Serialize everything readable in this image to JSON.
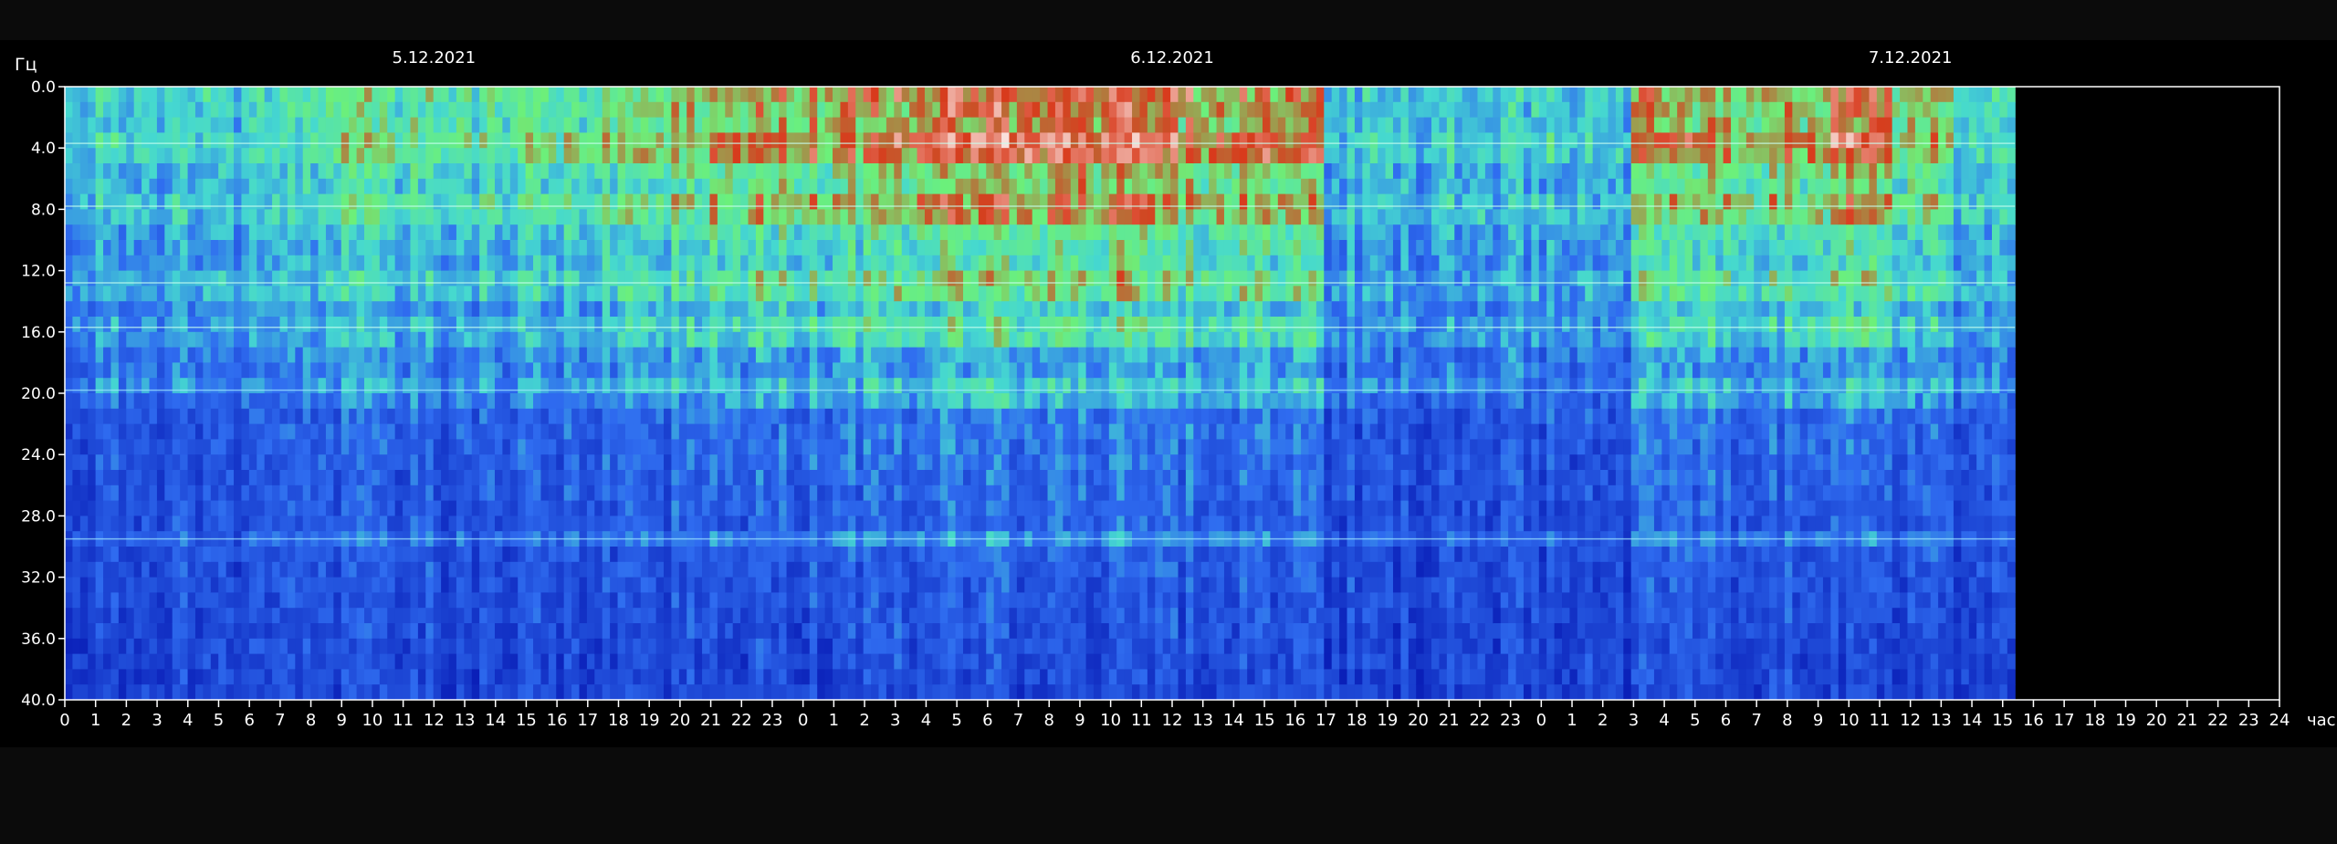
{
  "chart_data": {
    "type": "heatmap",
    "title": "",
    "ylabel": "Гц",
    "xlabel": "час",
    "ylim": [
      0,
      40
    ],
    "y_ticks": [
      "0.0",
      "4.0",
      "8.0",
      "12.0",
      "16.0",
      "20.0",
      "24.0",
      "28.0",
      "32.0",
      "36.0",
      "40.0"
    ],
    "x_range_hours": [
      0,
      72
    ],
    "x_ticks": [
      "0",
      "1",
      "2",
      "3",
      "4",
      "5",
      "6",
      "7",
      "8",
      "9",
      "10",
      "11",
      "12",
      "13",
      "14",
      "15",
      "16",
      "17",
      "18",
      "19",
      "20",
      "21",
      "22",
      "23",
      "0",
      "1",
      "2",
      "3",
      "4",
      "5",
      "6",
      "7",
      "8",
      "9",
      "10",
      "11",
      "12",
      "13",
      "14",
      "15",
      "16",
      "17",
      "18",
      "19",
      "20",
      "21",
      "22",
      "23",
      "0",
      "1",
      "2",
      "3",
      "4",
      "5",
      "6",
      "7",
      "8",
      "9",
      "10",
      "11",
      "12",
      "13",
      "14",
      "15",
      "16",
      "17",
      "18",
      "19",
      "20",
      "21",
      "22",
      "23",
      "24"
    ],
    "dates": [
      {
        "label": "5.12.2021",
        "hour": 12
      },
      {
        "label": "6.12.2021",
        "hour": 36
      },
      {
        "label": "7.12.2021",
        "hour": 60
      }
    ],
    "data_end_hour": 63.4,
    "resonance_lines_hz": [
      3.7,
      7.8,
      12.8,
      15.7,
      19.8,
      29.5
    ],
    "activity_periods": [
      {
        "start_hour": 0,
        "end_hour": 8.5,
        "level": 0.45
      },
      {
        "start_hour": 8.5,
        "end_hour": 17,
        "level": 0.6
      },
      {
        "start_hour": 17,
        "end_hour": 21,
        "level": 0.7
      },
      {
        "start_hour": 21,
        "end_hour": 27.5,
        "level": 0.85
      },
      {
        "start_hour": 27.5,
        "end_hour": 30.5,
        "level": 0.95
      },
      {
        "start_hour": 30.5,
        "end_hour": 35.5,
        "level": 1.0
      },
      {
        "start_hour": 35.5,
        "end_hour": 41,
        "level": 0.88
      },
      {
        "start_hour": 41,
        "end_hour": 51,
        "level": 0.42
      },
      {
        "start_hour": 51,
        "end_hour": 57.5,
        "level": 0.8
      },
      {
        "start_hour": 57.5,
        "end_hour": 59.5,
        "level": 1.0
      },
      {
        "start_hour": 59.5,
        "end_hour": 61.5,
        "level": 0.75
      },
      {
        "start_hour": 61.5,
        "end_hour": 63.4,
        "level": 0.5
      }
    ],
    "colors": {
      "background": "#000000",
      "frame": "#ffffff",
      "low": "#0a1fb8",
      "mid_low": "#2f6cf0",
      "mid": "#45d8d0",
      "mid_high": "#6cf07a",
      "high": "#d83a1c",
      "peak": "#ffffff"
    },
    "grid": false
  }
}
